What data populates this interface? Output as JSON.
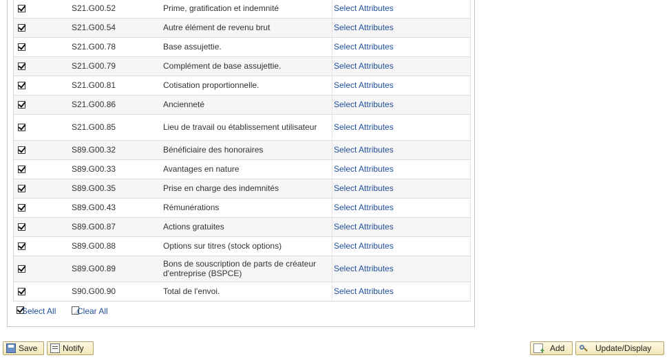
{
  "grid": {
    "rows": [
      {
        "checked": true,
        "code": "S21.G00.52",
        "description": "Prime, gratification et indemnité",
        "link": "Select Attributes"
      },
      {
        "checked": true,
        "code": "S21.G00.54",
        "description": "Autre élément de revenu brut",
        "link": "Select Attributes"
      },
      {
        "checked": true,
        "code": "S21.G00.78",
        "description": "Base assujettie.",
        "link": "Select Attributes"
      },
      {
        "checked": true,
        "code": "S21.G00.79",
        "description": "Complément de base assujettie.",
        "link": "Select Attributes"
      },
      {
        "checked": true,
        "code": "S21.G00.81",
        "description": "Cotisation proportionnelle.",
        "link": "Select Attributes"
      },
      {
        "checked": true,
        "code": "S21.G00.86",
        "description": "Ancienneté",
        "link": "Select Attributes"
      },
      {
        "checked": true,
        "code": "S21.G00.85",
        "description": "Lieu de travail ou établissement utilisateur",
        "link": "Select Attributes"
      },
      {
        "checked": true,
        "code": "S89.G00.32",
        "description": "Bénéficiaire des honoraires",
        "link": "Select Attributes"
      },
      {
        "checked": true,
        "code": "S89.G00.33",
        "description": "Avantages en nature",
        "link": "Select Attributes"
      },
      {
        "checked": true,
        "code": "S89.G00.35",
        "description": "Prise en charge des indemnités",
        "link": "Select Attributes"
      },
      {
        "checked": true,
        "code": "S89.G00.43",
        "description": "Rémunérations",
        "link": "Select Attributes"
      },
      {
        "checked": true,
        "code": "S89.G00.87",
        "description": "Actions gratuites",
        "link": "Select Attributes"
      },
      {
        "checked": true,
        "code": "S89.G00.88",
        "description": "Options sur titres (stock options)",
        "link": "Select Attributes"
      },
      {
        "checked": true,
        "code": "S89.G00.89",
        "description": "Bons de souscription de parts de créateur d'entreprise (BSPCE)",
        "link": "Select Attributes"
      },
      {
        "checked": true,
        "code": "S90.G00.90",
        "description": "Total de l'envoi.",
        "link": "Select Attributes"
      }
    ],
    "select_all_label": "Select All",
    "clear_all_label": "Clear All"
  },
  "toolbar": {
    "save_label": "Save",
    "notify_label": "Notify",
    "add_label": "Add",
    "update_display_label": "Update/Display",
    "save_icon": "floppy-disk-icon",
    "notify_icon": "notify-icon",
    "add_icon": "add-page-icon",
    "update_display_icon": "magnifier-icon"
  },
  "colors": {
    "link": "#1f4e9c",
    "button_bg": "#f2e6b8",
    "button_border": "#b5a36a"
  }
}
